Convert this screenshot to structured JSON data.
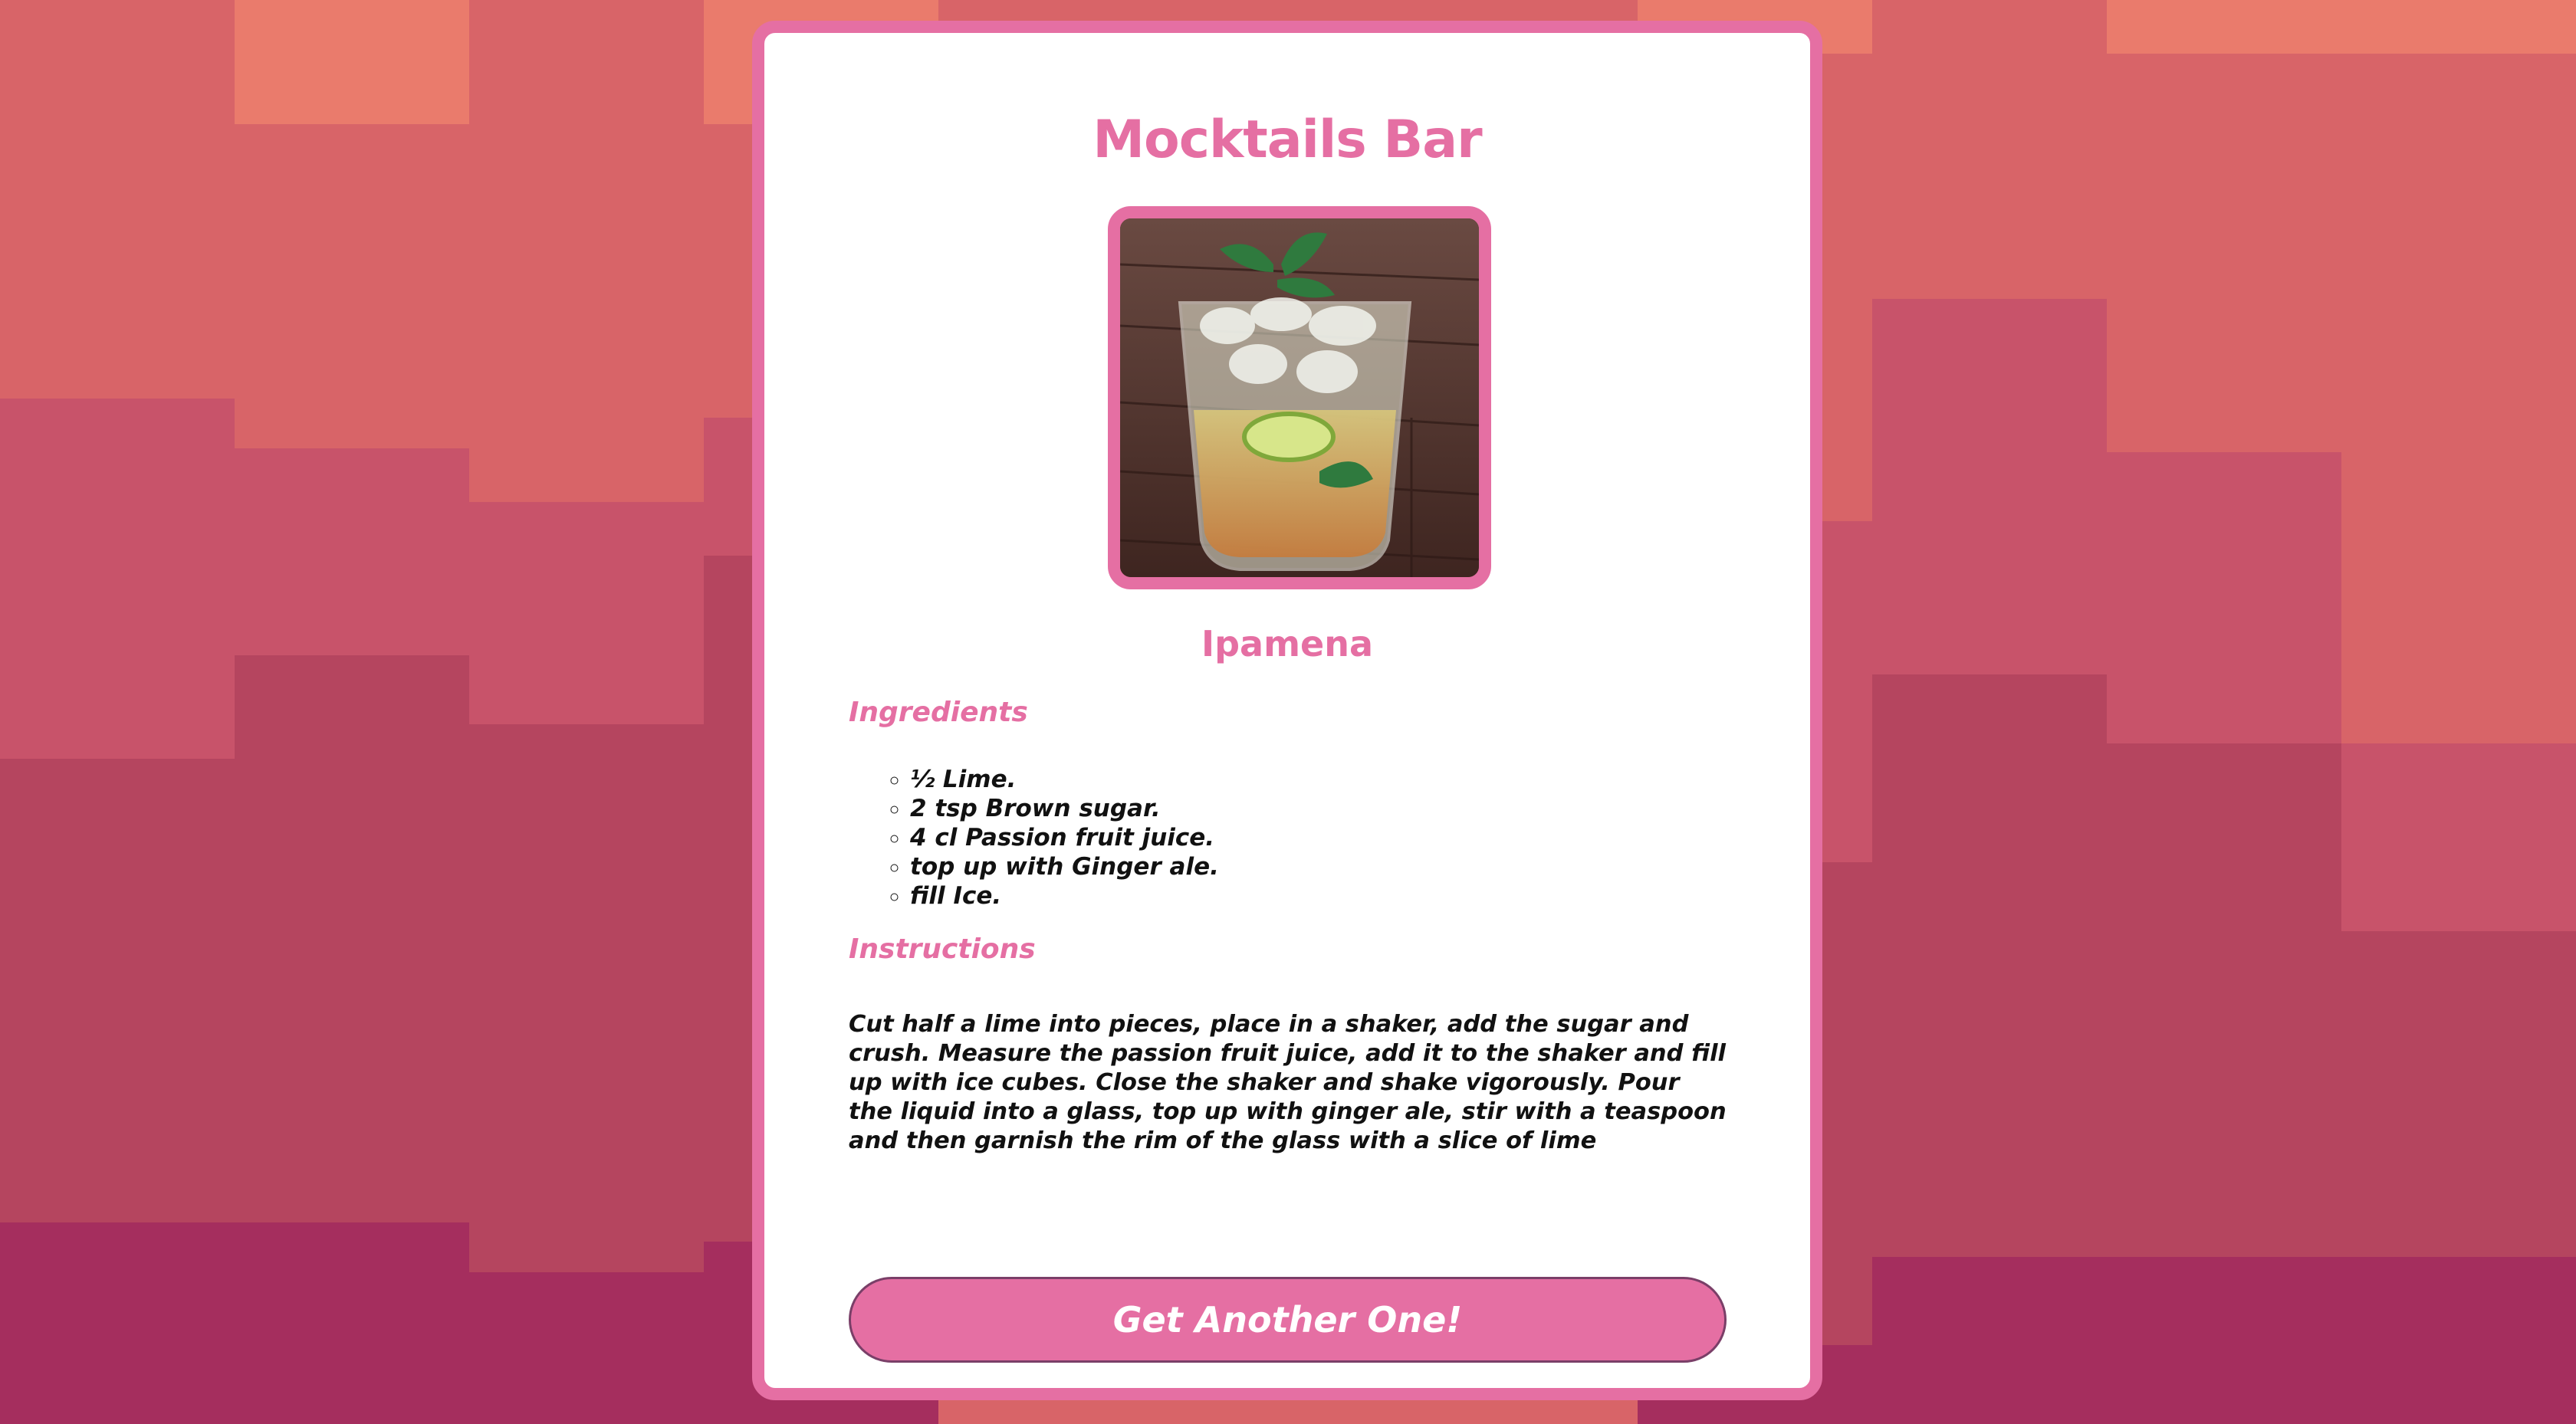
{
  "app": {
    "title": "Mocktails Bar"
  },
  "drink": {
    "name": "Ipamena",
    "image_alt": "Ipamena mocktail in a glass with lime and mint",
    "ingredients_heading": "Ingredients",
    "ingredients": [
      "½ Lime.",
      "2 tsp Brown sugar.",
      "4 cl Passion fruit juice.",
      "top up with Ginger ale.",
      "fill Ice."
    ],
    "instructions_heading": "Instructions",
    "instructions": "Cut half a lime into pieces, place in a shaker, add the sugar and crush. Measure the passion fruit juice, add it to the shaker and fill up with ice cubes. Close the shaker and shake vigorously. Pour the liquid into a glass, top up with ginger ale, stir with a teaspoon and then garnish the rim of the glass with a slice of lime"
  },
  "actions": {
    "another_label": "Get Another One!"
  },
  "colors": {
    "accent": "#e56fa3",
    "button_border": "#7a3f68",
    "text": "#111111",
    "card": "#ffffff",
    "bg_light": "#e97c6b",
    "bg_dark": "#a32d5e"
  }
}
